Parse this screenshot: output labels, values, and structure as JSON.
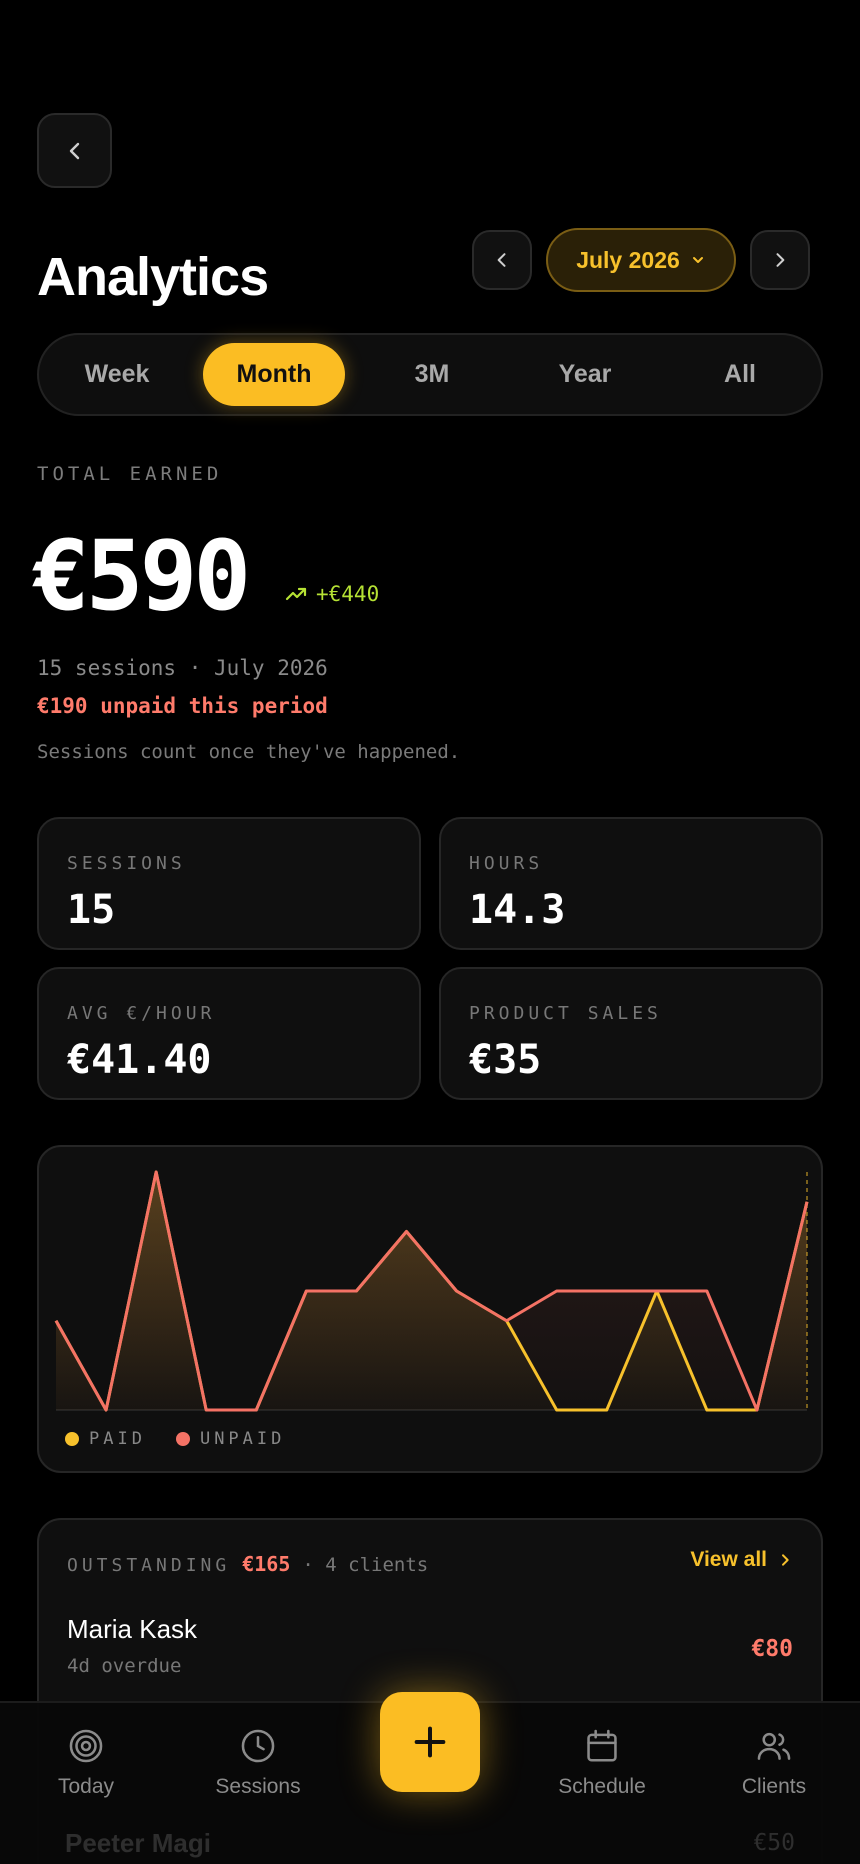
{
  "header": {
    "title": "Analytics",
    "month_label": "July 2026"
  },
  "period_tabs": [
    {
      "label": "Week",
      "active": false
    },
    {
      "label": "Month",
      "active": true
    },
    {
      "label": "3M",
      "active": false
    },
    {
      "label": "Year",
      "active": false
    },
    {
      "label": "All",
      "active": false
    }
  ],
  "summary": {
    "total_label": "TOTAL EARNED",
    "total_amount": "€590",
    "delta": "+€440",
    "sessions_line": "15 sessions · July 2026",
    "unpaid_line": "€190 unpaid this period",
    "note": "Sessions count once they've happened."
  },
  "stats": [
    {
      "label": "SESSIONS",
      "value": "15"
    },
    {
      "label": "HOURS",
      "value": "14.3"
    },
    {
      "label": "AVG €/HOUR",
      "value": "€41.40"
    },
    {
      "label": "PRODUCT SALES",
      "value": "€35"
    }
  ],
  "chart_data": {
    "type": "area",
    "x": [
      1,
      2,
      3,
      4,
      5,
      6,
      7,
      8,
      9,
      10,
      11,
      12,
      13,
      14,
      15,
      16
    ],
    "series": [
      {
        "name": "PAID",
        "color": "#f7c12c",
        "values": [
          30,
          0,
          80,
          0,
          0,
          40,
          40,
          60,
          40,
          30,
          0,
          0,
          40,
          0,
          0,
          70
        ]
      },
      {
        "name": "UNPAID",
        "color": "#f47265",
        "values": [
          30,
          0,
          80,
          0,
          0,
          40,
          40,
          60,
          40,
          30,
          40,
          40,
          40,
          40,
          0,
          70
        ]
      }
    ],
    "legend": "bottom-left",
    "grid": false
  },
  "outstanding": {
    "label": "OUTSTANDING",
    "amount": "€165",
    "clients": "· 4 clients",
    "view_all": "View all",
    "items": [
      {
        "name": "Maria Kask",
        "sub": "4d overdue",
        "amount": "€80"
      },
      {
        "name": "Peeter Magi",
        "amount": "€50"
      }
    ]
  },
  "tabbar": {
    "today": "Today",
    "sessions": "Sessions",
    "schedule": "Schedule",
    "clients": "Clients"
  },
  "colors": {
    "accent": "#fbbd23",
    "unpaid": "#f47265",
    "positive": "#b6e234"
  }
}
